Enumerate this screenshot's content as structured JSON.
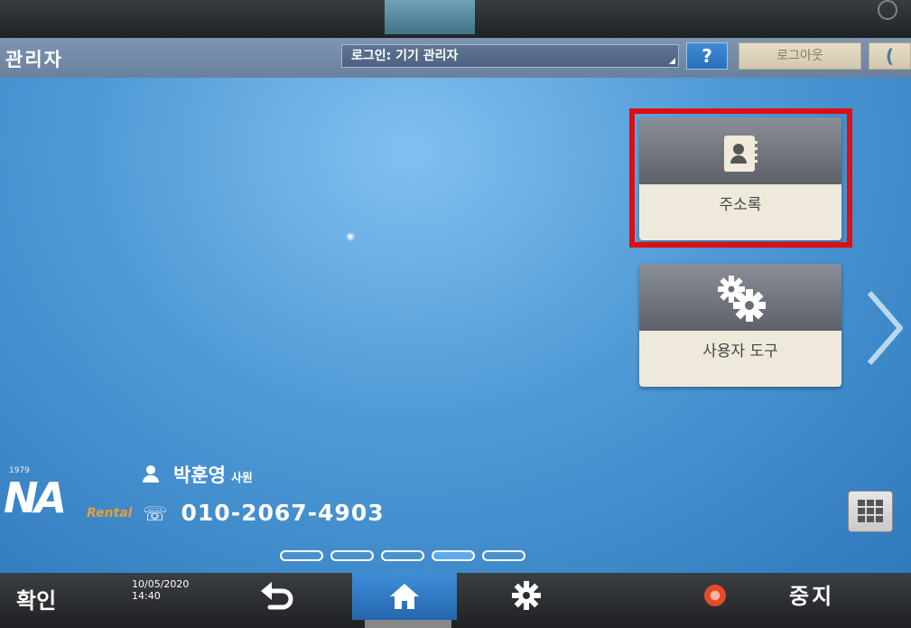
{
  "header": {
    "title": "관리자",
    "login_status": "로그인: 기기 관리자",
    "help_label": "?",
    "logout_label": "로그아웃",
    "sleep_label": "("
  },
  "tiles": [
    {
      "label": "주소록",
      "icon": "address-book-icon",
      "highlighted": true
    },
    {
      "label": "사용자 도구",
      "icon": "gears-icon",
      "highlighted": false
    }
  ],
  "sticker": {
    "logo_small": "1979",
    "logo_text": "NA",
    "logo_rental": "Rental",
    "contact_name": "박훈영",
    "contact_rank": "사원",
    "contact_phone": "010-2067-4903"
  },
  "pager": {
    "pages": 5,
    "current": 4
  },
  "bottom": {
    "confirm_label": "확인",
    "date": "10/05/2020",
    "time": "14:40",
    "stop_label": "중지"
  },
  "colors": {
    "highlight": "#e00d14",
    "home_button": "#2f7ac4",
    "header": "#7890ad"
  }
}
